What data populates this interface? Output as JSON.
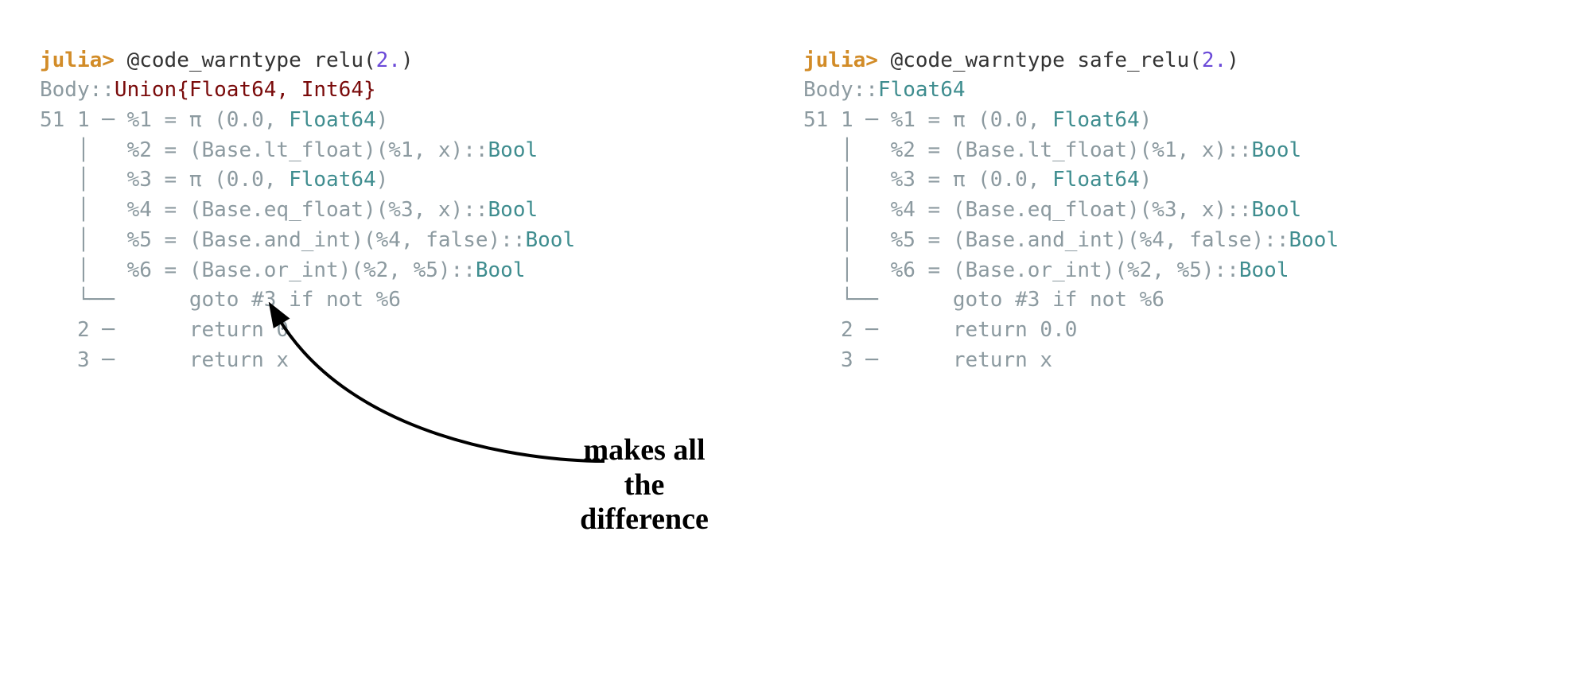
{
  "left": {
    "prompt": "julia>",
    "macro": " @code_warntype ",
    "func": "relu",
    "lp": "(",
    "arg": "2.",
    "rp": ")",
    "body_label": "Body::",
    "body_type": "Union{Float64, Int64}",
    "l1a": "51 1 ─ %1 = π (0.0, ",
    "l1b": "Float64",
    "l1c": ")",
    "l2a": "   │   %2 = (Base.lt_float)(%1, x)::",
    "l2b": "Bool",
    "l3a": "   │   %3 = π (0.0, ",
    "l3b": "Float64",
    "l3c": ")",
    "l4a": "   │   %4 = (Base.eq_float)(%3, x)::",
    "l4b": "Bool",
    "l5a": "   │   %5 = (Base.and_int)(%4, false)::",
    "l5b": "Bool",
    "l6a": "   │   %6 = (Base.or_int)(%2, %5)::",
    "l6b": "Bool",
    "l7": "   └──      goto #3 if not %6",
    "l8": "   2 ─      return 0",
    "l9": "   3 ─      return x"
  },
  "right": {
    "prompt": "julia>",
    "macro": " @code_warntype ",
    "func": "safe_relu",
    "lp": "(",
    "arg": "2.",
    "rp": ")",
    "body_label": "Body::",
    "body_type": "Float64",
    "l1a": "51 1 ─ %1 = π (0.0, ",
    "l1b": "Float64",
    "l1c": ")",
    "l2a": "   │   %2 = (Base.lt_float)(%1, x)::",
    "l2b": "Bool",
    "l3a": "   │   %3 = π (0.0, ",
    "l3b": "Float64",
    "l3c": ")",
    "l4a": "   │   %4 = (Base.eq_float)(%3, x)::",
    "l4b": "Bool",
    "l5a": "   │   %5 = (Base.and_int)(%4, false)::",
    "l5b": "Bool",
    "l6a": "   │   %6 = (Base.or_int)(%2, %5)::",
    "l6b": "Bool",
    "l7": "   └──      goto #3 if not %6",
    "l8": "   2 ─      return 0.0",
    "l9": "   3 ─      return x"
  },
  "annotation": {
    "line1": "makes all",
    "line2": "the",
    "line3": "difference"
  }
}
